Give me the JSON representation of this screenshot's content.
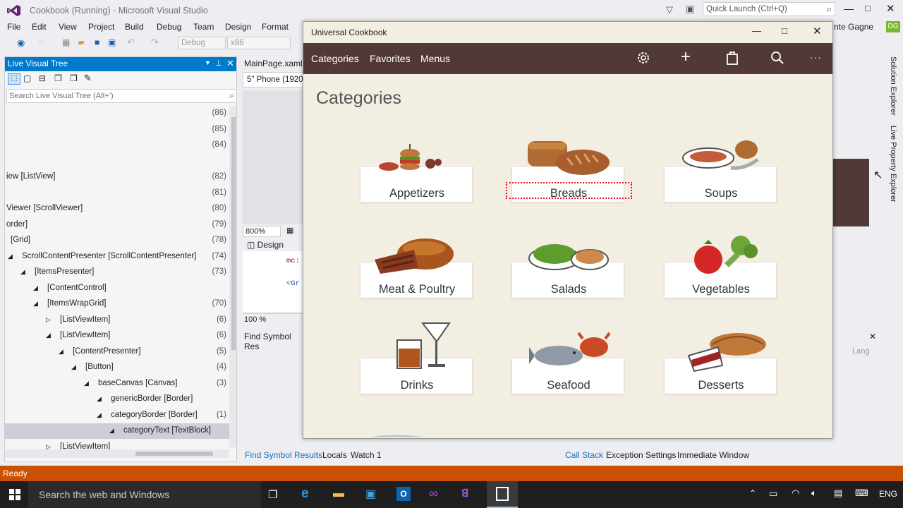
{
  "vs": {
    "title": "Cookbook (Running) - Microsoft Visual Studio",
    "quick_launch_placeholder": "Quick Launch (Ctrl+Q)",
    "user_name": "nte Gagne",
    "user_initials": "DG",
    "menu": [
      "File",
      "Edit",
      "View",
      "Project",
      "Build",
      "Debug",
      "Team",
      "Design",
      "Format"
    ],
    "toolbar_config": "Debug",
    "toolbar_platform": "x86"
  },
  "live_tree": {
    "title": "Live Visual Tree",
    "search_placeholder": "Search Live Visual Tree (Alt+')",
    "rows": [
      {
        "label": "",
        "count": "(86)",
        "indent": 0,
        "selected": false
      },
      {
        "label": "",
        "count": "(85)",
        "indent": 0,
        "selected": false
      },
      {
        "label": "",
        "count": "(84)",
        "indent": 0,
        "selected": false
      },
      {
        "label": "",
        "count": "",
        "indent": 0,
        "selected": false
      },
      {
        "label": "iew [ListView]",
        "count": "(82)",
        "indent": 0,
        "selected": false
      },
      {
        "label": "",
        "count": "(81)",
        "indent": 0,
        "selected": false
      },
      {
        "label": "Viewer [ScrollViewer]",
        "count": "(80)",
        "indent": 0,
        "selected": false
      },
      {
        "label": "order]",
        "count": "(79)",
        "indent": 0,
        "selected": false
      },
      {
        "label": "[Grid]",
        "count": "(78)",
        "indent": 6,
        "selected": false
      },
      {
        "label": "ScrollContentPresenter [ScrollContentPresenter]",
        "count": "(74)",
        "indent": 22,
        "selected": false
      },
      {
        "label": "[ItemsPresenter]",
        "count": "(73)",
        "indent": 40,
        "selected": false
      },
      {
        "label": "[ContentControl]",
        "count": "",
        "indent": 58,
        "selected": false
      },
      {
        "label": "[ItemsWrapGrid]",
        "count": "(70)",
        "indent": 58,
        "selected": false
      },
      {
        "label": "[ListViewItem]",
        "count": "(6)",
        "indent": 76,
        "selected": false
      },
      {
        "label": "[ListViewItem]",
        "count": "(6)",
        "indent": 76,
        "selected": false
      },
      {
        "label": "[ContentPresenter]",
        "count": "(5)",
        "indent": 94,
        "selected": false
      },
      {
        "label": "[Button]",
        "count": "(4)",
        "indent": 112,
        "selected": false
      },
      {
        "label": "baseCanvas [Canvas]",
        "count": "(3)",
        "indent": 130,
        "selected": false
      },
      {
        "label": "genericBorder [Border]",
        "count": "",
        "indent": 148,
        "selected": false
      },
      {
        "label": "categoryBorder [Border]",
        "count": "(1)",
        "indent": 148,
        "selected": false
      },
      {
        "label": "categoryText [TextBlock]",
        "count": "",
        "indent": 166,
        "selected": true
      },
      {
        "label": "[ListViewItem]",
        "count": "",
        "indent": 76,
        "selected": false
      }
    ]
  },
  "editor": {
    "tab": "MainPage.xaml",
    "device": "5\" Phone (1920",
    "zoom": "800%",
    "design_tab": "Design",
    "code_line1": "mc:",
    "code_line2": "<Gr",
    "zoom2": "100 %",
    "find_title": "Find Symbol Res"
  },
  "app": {
    "window_title": "Universal Cookbook",
    "nav": [
      "Categories",
      "Favorites",
      "Menus"
    ],
    "heading": "Categories",
    "categories": [
      {
        "name": "Appetizers",
        "icon": "appetizers-icon",
        "selected": false
      },
      {
        "name": "Breads",
        "icon": "breads-icon",
        "selected": true
      },
      {
        "name": "Soups",
        "icon": "soups-icon",
        "selected": false
      },
      {
        "name": "Meat & Poultry",
        "icon": "meat-icon",
        "selected": false
      },
      {
        "name": "Salads",
        "icon": "salads-icon",
        "selected": false
      },
      {
        "name": "Vegetables",
        "icon": "vegetables-icon",
        "selected": false
      },
      {
        "name": "Drinks",
        "icon": "drinks-icon",
        "selected": false
      },
      {
        "name": "Seafood",
        "icon": "seafood-icon",
        "selected": false
      },
      {
        "name": "Desserts",
        "icon": "desserts-icon",
        "selected": false
      }
    ]
  },
  "bottom": {
    "left_tabs": [
      "Find Symbol Results",
      "Locals",
      "Watch 1"
    ],
    "right_tabs": [
      "Call Stack",
      "Exception Settings",
      "Immediate Window"
    ],
    "lang": "Lang"
  },
  "side_tabs": [
    "Solution Explorer",
    "Live Property Explorer"
  ],
  "status": "Ready",
  "taskbar": {
    "search_placeholder": "Search the web and Windows",
    "lang": "ENG"
  },
  "colors": {
    "vs_accent": "#007acc",
    "status_bar": "#ca5100",
    "app_nav": "#513938",
    "app_bg": "#f3eee2",
    "selection_outline": "#e81123"
  }
}
